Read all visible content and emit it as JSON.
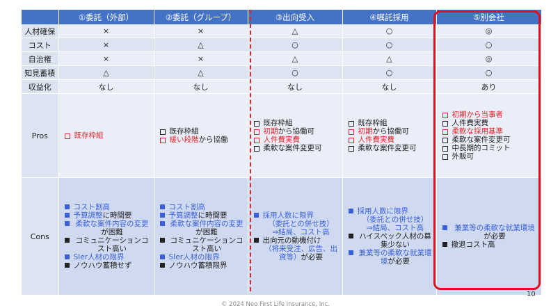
{
  "headers": [
    "",
    "①委託（外部）",
    "②委託（グループ）",
    "③出向受入",
    "④嘱託採用",
    "⑤別会社"
  ],
  "rows": [
    {
      "label": "人材確保",
      "cells": [
        "×",
        "×",
        "△",
        "○",
        "◎"
      ]
    },
    {
      "label": "コスト",
      "cells": [
        "×",
        "△",
        "○",
        "○",
        "○"
      ]
    },
    {
      "label": "自治権",
      "cells": [
        "×",
        "×",
        "△",
        "△",
        "◎"
      ]
    },
    {
      "label": "知見蓄積",
      "cells": [
        "△",
        "△",
        "○",
        "○",
        "○"
      ]
    },
    {
      "label": "収益化",
      "cells": [
        "なし",
        "なし",
        "なし",
        "なし",
        "あり"
      ]
    }
  ],
  "pros": {
    "label": "Pros",
    "c1": [
      "既存枠組"
    ],
    "c2": [
      "既存枠組",
      "緩い段階",
      "から協働"
    ],
    "c3": [
      "既存枠組",
      "初期",
      "から協働可",
      "人件費実費",
      "柔軟な案件変更可"
    ],
    "c4": [
      "既存枠組",
      "初期",
      "から協働可",
      "人件費実費",
      "柔軟な案件変更可"
    ],
    "c5": [
      "初期から当事者",
      "人件費実費",
      "柔軟な採用基準",
      "柔軟な案件変更可",
      "中長期的コミット",
      "外販可"
    ]
  },
  "cons": {
    "label": "Cons",
    "c1": [
      "コスト割高",
      "予算調整",
      "に時間要",
      "柔軟な案件内容の変更",
      "が困難",
      "コミュニケーションコスト高い",
      "SIer人材の限界",
      "ノウハウ蓄積せず"
    ],
    "c2": [
      "コスト割高",
      "予算調整",
      "に時間要",
      "柔軟な案件内容の変更",
      "が困難",
      "コミュニケーションコスト高い",
      "SIer人材の限界",
      "ノウハウ蓄積限界"
    ],
    "c3": [
      "採用人数に限界",
      "（委託との併せ技）",
      "⇒結局、コスト高",
      "出向元の動機付け",
      "（将来受注、広告、出資等）",
      "が必要"
    ],
    "c4": [
      "採用人数に限界",
      "（委託との併せ技）",
      "⇒結局、コスト高",
      "ハイスペック人材の募集少ない",
      "兼業等の柔軟な就業環境",
      "が必要"
    ],
    "c5": [
      "兼業等の柔軟な就業環境",
      "が必要",
      "撤退コスト高"
    ]
  },
  "page_number": "10",
  "copyright": "© 2024 Neo First Life Insurance, Inc."
}
